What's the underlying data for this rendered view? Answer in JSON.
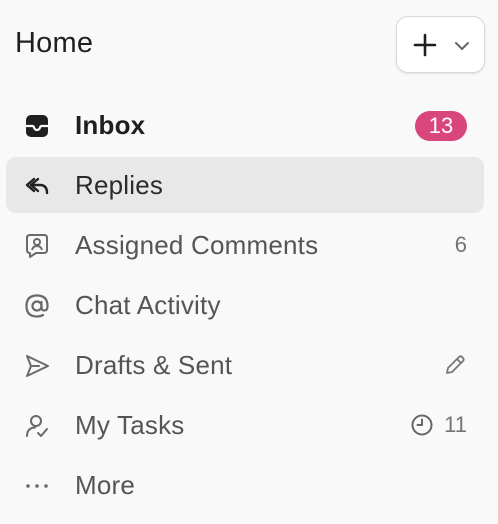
{
  "header": {
    "title": "Home",
    "add_button": {
      "plus_icon": "plus-icon",
      "chevron_icon": "chevron-down-icon"
    }
  },
  "colors": {
    "badge_bg": "#d9467b",
    "active_bg": "#e8e8e8",
    "muted_text": "#555555"
  },
  "nav": {
    "items": [
      {
        "label": "Inbox",
        "icon": "inbox-tray-icon",
        "badge": "13"
      },
      {
        "label": "Replies",
        "icon": "reply-arrow-icon"
      },
      {
        "label": "Assigned Comments",
        "icon": "assigned-comment-icon",
        "count": "6"
      },
      {
        "label": "Chat Activity",
        "icon": "at-sign-icon"
      },
      {
        "label": "Drafts & Sent",
        "icon": "send-icon",
        "trailing_icon": "pencil-icon"
      },
      {
        "label": "My Tasks",
        "icon": "task-person-icon",
        "trailing_icon": "clock-icon",
        "count": "11"
      },
      {
        "label": "More",
        "icon": "more-dots-icon"
      }
    ]
  }
}
